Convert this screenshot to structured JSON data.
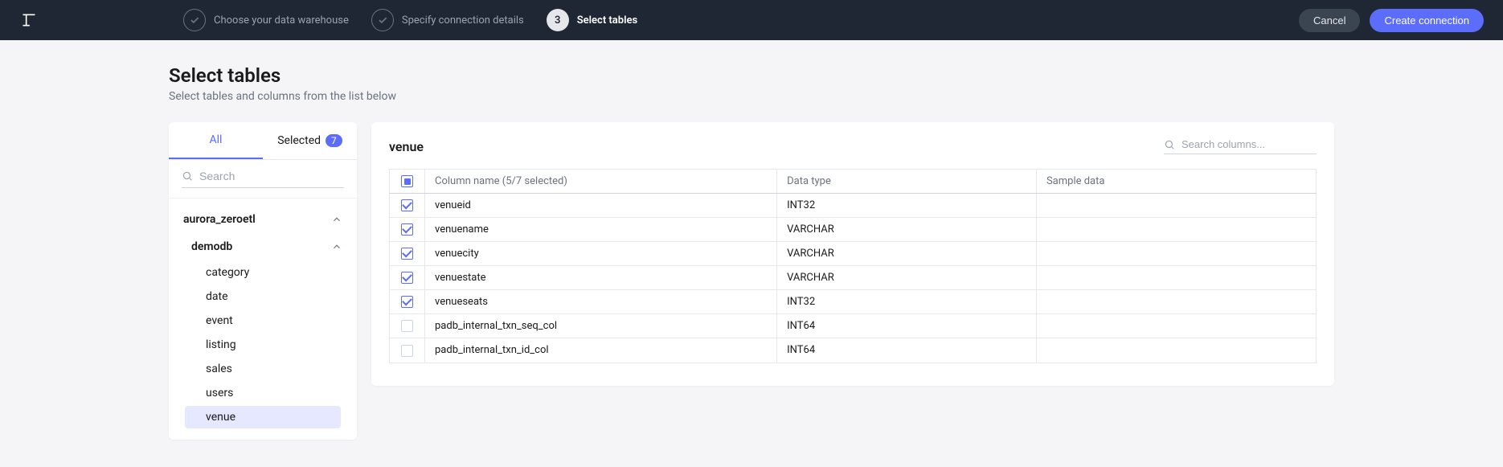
{
  "header": {
    "steps": [
      {
        "label": "Choose your data warehouse",
        "done": true
      },
      {
        "label": "Specify connection details",
        "done": true
      },
      {
        "number": "3",
        "label": "Select tables",
        "active": true
      }
    ],
    "cancel_label": "Cancel",
    "create_label": "Create connection"
  },
  "page": {
    "title": "Select tables",
    "subtitle": "Select tables and columns from the list below"
  },
  "sidebar": {
    "tab_all": "All",
    "tab_selected": "Selected",
    "selected_count": "7",
    "search_placeholder": "Search",
    "schema_name": "aurora_zeroetl",
    "db_name": "demodb",
    "tables": [
      {
        "name": "category",
        "active": false
      },
      {
        "name": "date",
        "active": false
      },
      {
        "name": "event",
        "active": false
      },
      {
        "name": "listing",
        "active": false
      },
      {
        "name": "sales",
        "active": false
      },
      {
        "name": "users",
        "active": false
      },
      {
        "name": "venue",
        "active": true
      }
    ]
  },
  "detail": {
    "title": "venue",
    "column_search_placeholder": "Search columns...",
    "header_checkbox_state": "indeterminate",
    "col_header_name": "Column name (5/7 selected)",
    "col_header_type": "Data type",
    "col_header_sample": "Sample data",
    "rows": [
      {
        "checked": true,
        "name": "venueid",
        "type": "INT32",
        "sample": ""
      },
      {
        "checked": true,
        "name": "venuename",
        "type": "VARCHAR",
        "sample": ""
      },
      {
        "checked": true,
        "name": "venuecity",
        "type": "VARCHAR",
        "sample": ""
      },
      {
        "checked": true,
        "name": "venuestate",
        "type": "VARCHAR",
        "sample": ""
      },
      {
        "checked": true,
        "name": "venueseats",
        "type": "INT32",
        "sample": ""
      },
      {
        "checked": false,
        "name": "padb_internal_txn_seq_col",
        "type": "INT64",
        "sample": ""
      },
      {
        "checked": false,
        "name": "padb_internal_txn_id_col",
        "type": "INT64",
        "sample": ""
      }
    ]
  }
}
